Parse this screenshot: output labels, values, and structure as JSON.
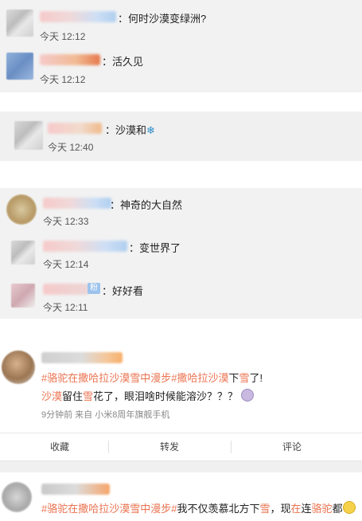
{
  "comments_block_1": [
    {
      "text": "：何时沙漠变绿洲?",
      "time": "今天 12:12"
    },
    {
      "text": "：活久见",
      "time": "今天 12:12"
    }
  ],
  "comments_block_2": [
    {
      "text": "：沙漠和",
      "emoji": "snowflake-icon",
      "time": "今天 12:40"
    }
  ],
  "comments_block_3": [
    {
      "text": "：神奇的大自然",
      "time": "今天 12:33"
    },
    {
      "text": "：变世界了",
      "time": "今天 12:14"
    },
    {
      "text": "：好好看",
      "badge": "粉",
      "time": "今天 12:11"
    }
  ],
  "post_1": {
    "line1_hashtag1": "#骆驼在撒哈拉沙漠雪中漫步",
    "line1_hashtag2": "#撒哈拉沙漠",
    "line1_tail_1": "下",
    "line1_tail_2": "雪",
    "line1_tail_3": "了!",
    "line2_1": "沙漠",
    "line2_2": "留住",
    "line2_3": "雪",
    "line2_4": "花了，眼泪啥时候能溶沙？？？",
    "meta": "9分钟前  来自 小米8周年旗舰手机"
  },
  "actions": {
    "collect": "收藏",
    "repost": "转发",
    "comment": "评论"
  },
  "post_2": {
    "hashtag1": "#骆驼在撒哈拉沙漠雪中漫步",
    "hashtag2": "#",
    "text1": "我不仅羡慕北方下",
    "text2": "雪",
    "text3": "，现",
    "text4": "在",
    "text5": "连",
    "text6": "骆驼",
    "text7": "都"
  },
  "colors": {
    "accent_red": "#eb7350",
    "link_blue": "#4a7bd0",
    "time_gray": "#555555"
  }
}
